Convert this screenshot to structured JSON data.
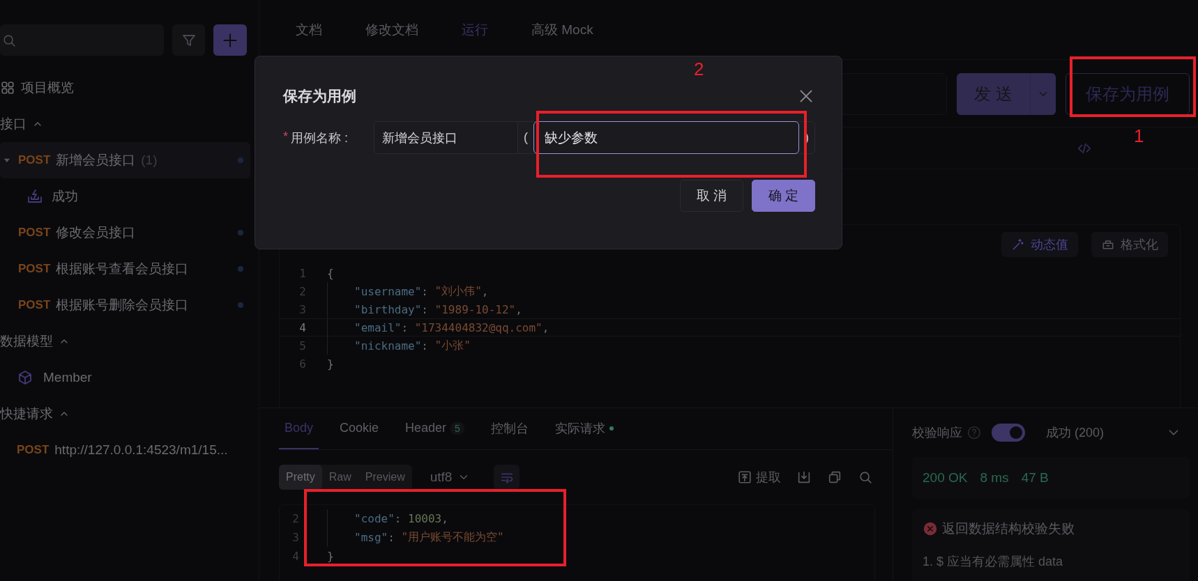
{
  "sidebar": {
    "items": [
      {
        "kind": "overview",
        "label": "项目概览"
      },
      {
        "kind": "group",
        "label": "接口",
        "expanded": true,
        "children": [
          {
            "kind": "endpoint",
            "method": "POST",
            "label": "新增会员接口",
            "count": "(1)",
            "selected": true,
            "expanded": true,
            "children": [
              {
                "kind": "case",
                "label": "成功",
                "selected": false
              }
            ]
          },
          {
            "kind": "endpoint",
            "method": "POST",
            "label": "修改会员接口",
            "selected": false,
            "expanded": false
          },
          {
            "kind": "endpoint",
            "method": "POST",
            "label": "根据账号查看会员接口",
            "selected": false,
            "expanded": false
          },
          {
            "kind": "endpoint",
            "method": "POST",
            "label": "根据账号删除会员接口",
            "selected": false,
            "expanded": false
          }
        ]
      },
      {
        "kind": "group",
        "label": "数据模型",
        "expanded": true,
        "children": [
          {
            "kind": "model",
            "label": "Member",
            "selected": false
          }
        ]
      },
      {
        "kind": "group",
        "label": "快捷请求",
        "expanded": true,
        "children": [
          {
            "kind": "request",
            "method": "POST",
            "label": "http://127.0.0.1:4523/m1/15...",
            "selected": false
          }
        ]
      }
    ]
  },
  "tabs": [
    {
      "label": "文档",
      "selected": false
    },
    {
      "label": "修改文档",
      "selected": false
    },
    {
      "label": "运行",
      "selected": true
    },
    {
      "label": "高级 Mock",
      "selected": false
    }
  ],
  "request": {
    "send_label": "发 送",
    "save_label": "保存为用例"
  },
  "body_toolbar": [
    {
      "kind": "dynamic",
      "label": "动态值"
    },
    {
      "kind": "format",
      "label": "格式化"
    }
  ],
  "body_editor": {
    "lines": [
      {
        "number": "1",
        "indented": false,
        "highlighted": false,
        "tokens": [
          {
            "kind": "punct",
            "text": "{"
          }
        ]
      },
      {
        "number": "2",
        "indented": true,
        "highlighted": false,
        "tokens": [
          {
            "kind": "key",
            "text": "\"username\""
          },
          {
            "kind": "punct",
            "text": ": "
          },
          {
            "kind": "string",
            "text": "\"刘小伟\""
          },
          {
            "kind": "punct",
            "text": ","
          }
        ]
      },
      {
        "number": "3",
        "indented": true,
        "highlighted": false,
        "tokens": [
          {
            "kind": "key",
            "text": "\"birthday\""
          },
          {
            "kind": "punct",
            "text": ": "
          },
          {
            "kind": "string",
            "text": "\"1989-10-12\""
          },
          {
            "kind": "punct",
            "text": ","
          }
        ]
      },
      {
        "number": "4",
        "indented": true,
        "highlighted": true,
        "tokens": [
          {
            "kind": "key",
            "text": "\"email\""
          },
          {
            "kind": "punct",
            "text": ": "
          },
          {
            "kind": "string",
            "text": "\"1734404832@qq.com\""
          },
          {
            "kind": "punct",
            "text": ","
          }
        ]
      },
      {
        "number": "5",
        "indented": true,
        "highlighted": false,
        "tokens": [
          {
            "kind": "key",
            "text": "\"nickname\""
          },
          {
            "kind": "punct",
            "text": ": "
          },
          {
            "kind": "string",
            "text": "\"小张\""
          }
        ]
      },
      {
        "number": "6",
        "indented": false,
        "highlighted": false,
        "tokens": [
          {
            "kind": "punct",
            "text": "}"
          }
        ]
      }
    ]
  },
  "response": {
    "tabs": [
      {
        "label": "Body",
        "selected": true
      },
      {
        "label": "Cookie",
        "selected": false
      },
      {
        "label": "Header",
        "badge": "5",
        "selected": false
      },
      {
        "label": "控制台",
        "selected": false
      },
      {
        "label": "实际请求",
        "dot": true,
        "selected": false
      }
    ],
    "views": [
      {
        "label": "Pretty",
        "selected": true
      },
      {
        "label": "Raw",
        "selected": false
      },
      {
        "label": "Preview",
        "selected": false
      }
    ],
    "encoding": "utf8",
    "actions": [
      {
        "kind": "extract",
        "label": "提取"
      },
      {
        "kind": "download"
      },
      {
        "kind": "copy"
      },
      {
        "kind": "search"
      }
    ],
    "lines": [
      {
        "number": "2",
        "indented": true,
        "highlighted": false,
        "tokens": [
          {
            "kind": "key",
            "text": "\"code\""
          },
          {
            "kind": "punct",
            "text": ": "
          },
          {
            "kind": "number",
            "text": "10003"
          },
          {
            "kind": "punct",
            "text": ","
          }
        ]
      },
      {
        "number": "3",
        "indented": true,
        "highlighted": false,
        "tokens": [
          {
            "kind": "key",
            "text": "\"msg\""
          },
          {
            "kind": "punct",
            "text": ": "
          },
          {
            "kind": "string",
            "text": "\"用户账号不能为空\""
          }
        ]
      },
      {
        "number": "4",
        "indented": false,
        "highlighted": false,
        "tokens": [
          {
            "kind": "punct",
            "text": "}"
          }
        ]
      }
    ]
  },
  "validation": {
    "label": "校验响应",
    "on": true,
    "response_option": "成功 (200)",
    "status": "200 OK",
    "time": "8 ms",
    "size": "47 B",
    "result": {
      "title": "返回数据结构校验失败",
      "errors": [
        "1. $ 应当有必需属性 data"
      ]
    }
  },
  "dialog": {
    "title": "保存为用例",
    "field": {
      "label": "用例名称 :",
      "required_mark": "*",
      "prefix": "新增会员接口",
      "open": "(",
      "value": "缺少参数",
      "close": ")"
    },
    "buttons": [
      {
        "kind": "secondary",
        "label": "取 消"
      },
      {
        "kind": "primary",
        "label": "确 定"
      }
    ]
  },
  "annotations": [
    {
      "kind": "save",
      "label": "1"
    },
    {
      "kind": "field",
      "label": "2"
    },
    {
      "kind": "response"
    }
  ]
}
